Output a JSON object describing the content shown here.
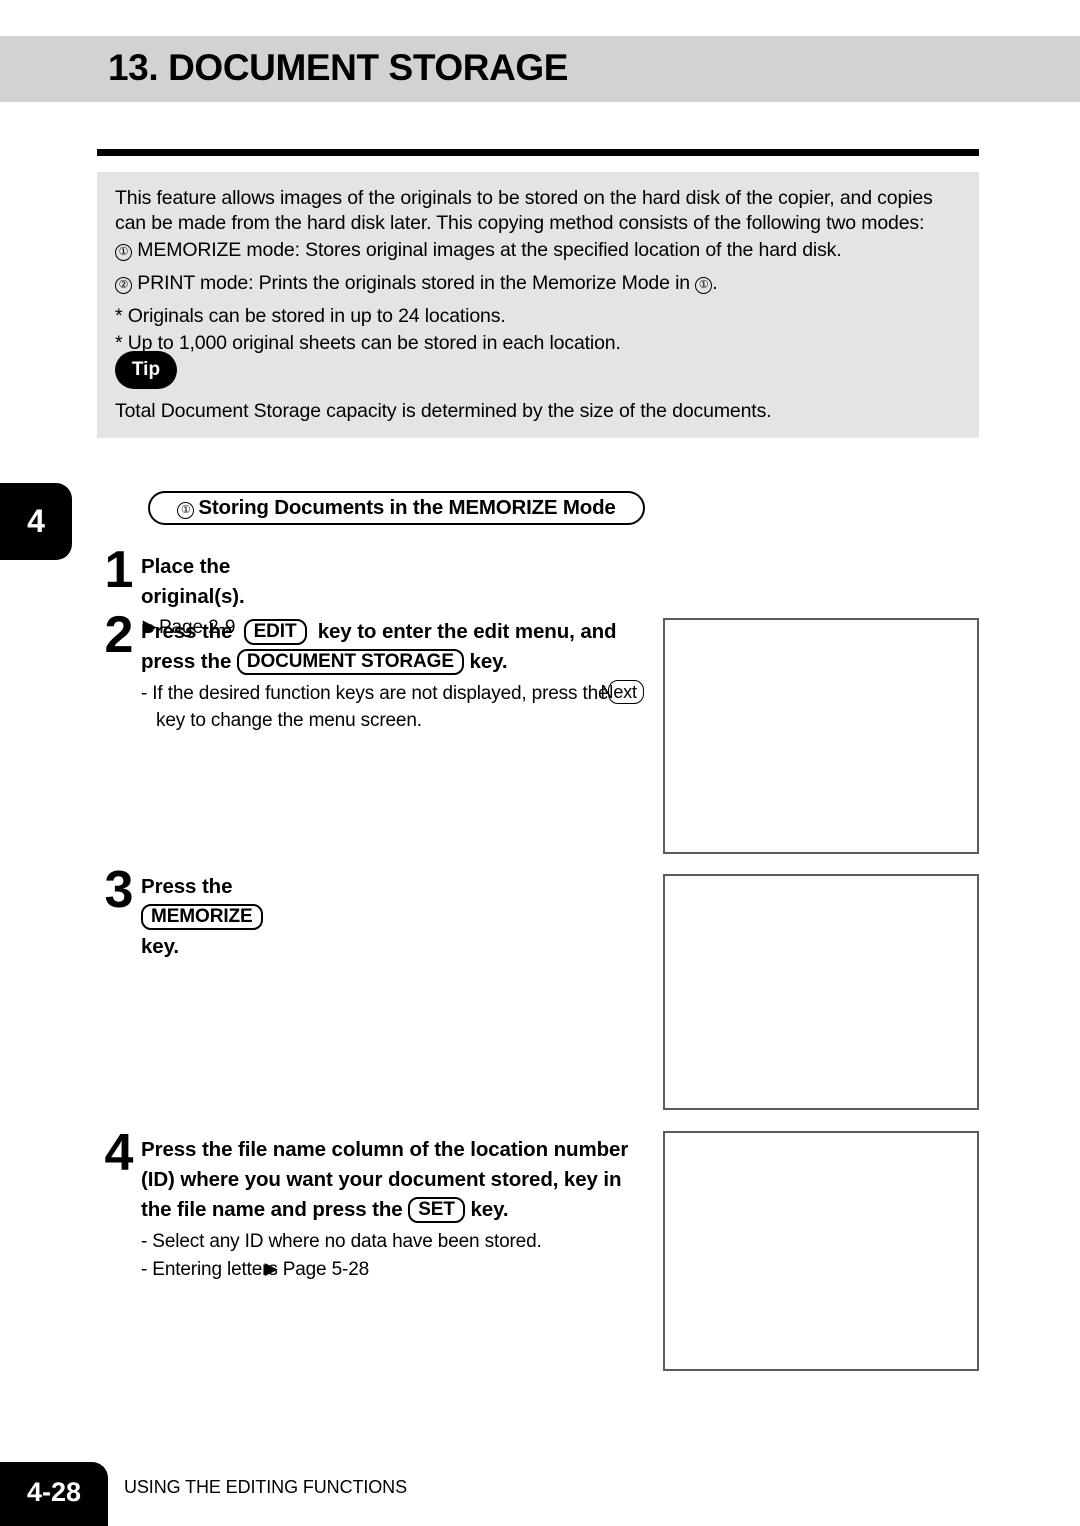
{
  "header": {
    "title": "13. DOCUMENT STORAGE",
    "band_color": "#d2d2d2"
  },
  "intro": {
    "panel_color": "#e4e4e4",
    "paragraph_1": "This feature allows images of the originals to be stored on the hard disk of the copier, and copies can be made from the hard disk later. This copying method consists of the following two modes:",
    "mode_1_marker": "①",
    "mode_1": "MEMORIZE mode: Stores original images at the specified location of the hard disk.",
    "mode_2_marker": "②",
    "mode_2_pre": "PRINT mode: Prints the originals stored in the Memorize Mode in",
    "mode_2_marker_inline": "①",
    "mode_2_post": ".",
    "note_1": "* Originals can be stored in up to 24 locations.",
    "note_2": "* Up to 1,000 original sheets can be stored in each location.",
    "tip_label": "Tip",
    "tip_text": "Total Document Storage capacity is determined by the size of the documents."
  },
  "chapter_tab": {
    "number": "4"
  },
  "section": {
    "marker": "①",
    "title": "Storing Documents in the MEMORIZE Mode"
  },
  "steps": [
    {
      "number": "1",
      "head_text": "Place the original(s).",
      "arrow": "▶",
      "page_ref": "Page 2-9"
    },
    {
      "number": "2",
      "line1_a": "Press the",
      "key1": "EDIT",
      "line1_b": "key to enter the edit menu, and",
      "line2_a": "press the",
      "key2": "DOCUMENT STORAGE",
      "line2_b": "key.",
      "sub1_a": "- If the desired function keys are not displayed, press the",
      "sub1_key": "Next",
      "sub2": "key to change the menu screen."
    },
    {
      "number": "3",
      "head_a": "Press the",
      "key": "MEMORIZE",
      "head_b": "key."
    },
    {
      "number": "4",
      "line1": "Press the  file name column of the location number",
      "line2": "(ID) where you want your document stored, key in",
      "line3_a": "the file name and press the",
      "key": "SET",
      "line3_b": "key.",
      "sub1": "-  Select any ID where no data have been stored.",
      "sub2_a": "-  Entering letters",
      "sub2_arrow": "▶",
      "sub2_page": "Page 5-28"
    }
  ],
  "illustrations": [
    {
      "name": "illustration-box-step2"
    },
    {
      "name": "illustration-box-step3"
    },
    {
      "name": "illustration-box-step4"
    }
  ],
  "footer": {
    "page_number": "4-28",
    "section_name": "USING THE EDITING FUNCTIONS"
  }
}
